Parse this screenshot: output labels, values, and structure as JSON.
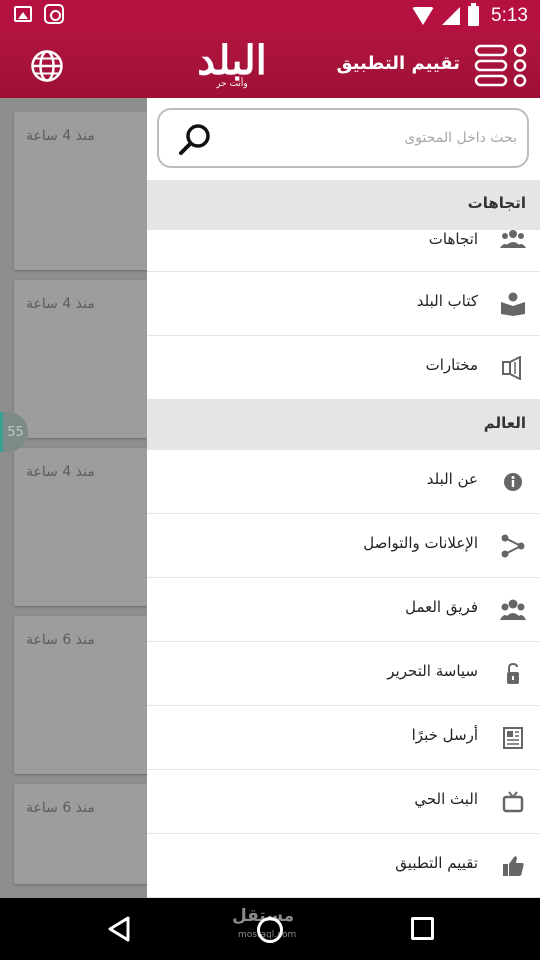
{
  "status_bar": {
    "time": "5:13",
    "icons": [
      "image-icon",
      "instagram-icon",
      "wifi-icon",
      "signal-icon",
      "battery-icon"
    ]
  },
  "app_bar": {
    "title": "تقييم التطبيق",
    "logo_text": "البلد",
    "logo_tagline": "وأنت حر",
    "icons": [
      "globe-icon",
      "menu-icon"
    ]
  },
  "search": {
    "placeholder": "بحث داخل المحتوى"
  },
  "feed": {
    "cards": [
      {
        "time": "منذ 4 ساعة"
      },
      {
        "time": "منذ 4 ساعة"
      },
      {
        "time": "منذ 4 ساعة"
      },
      {
        "time": "منذ 6 ساعة"
      },
      {
        "time": "منذ 6 ساعة"
      }
    ],
    "badge": "55"
  },
  "drawer": {
    "section1": {
      "title": "اتجاهات",
      "items": [
        {
          "label": "اتجاهات",
          "icon": "group-icon"
        },
        {
          "label": "كتاب البلد",
          "icon": "reader-icon"
        },
        {
          "label": "مختارات",
          "icon": "speaker-icon"
        }
      ]
    },
    "section2": {
      "title": "العالم",
      "items": [
        {
          "label": "عن البلد",
          "icon": "info-icon"
        },
        {
          "label": "الإعلانات والتواصل",
          "icon": "share-icon"
        },
        {
          "label": "فريق العمل",
          "icon": "team-icon"
        },
        {
          "label": "سياسة التحرير",
          "icon": "lock-icon"
        },
        {
          "label": "أرسل خبرًا",
          "icon": "news-icon"
        },
        {
          "label": "البث الحي",
          "icon": "tv-icon"
        },
        {
          "label": "تقييم التطبيق",
          "icon": "thumbs-up-icon"
        }
      ]
    }
  },
  "nav_bar": {
    "watermark": "مستقل",
    "watermark_sub": "mostaql.com"
  },
  "colors": {
    "brand": "#b5103f",
    "header_gray": "#e5e5e5",
    "icon_gray": "#666666"
  }
}
